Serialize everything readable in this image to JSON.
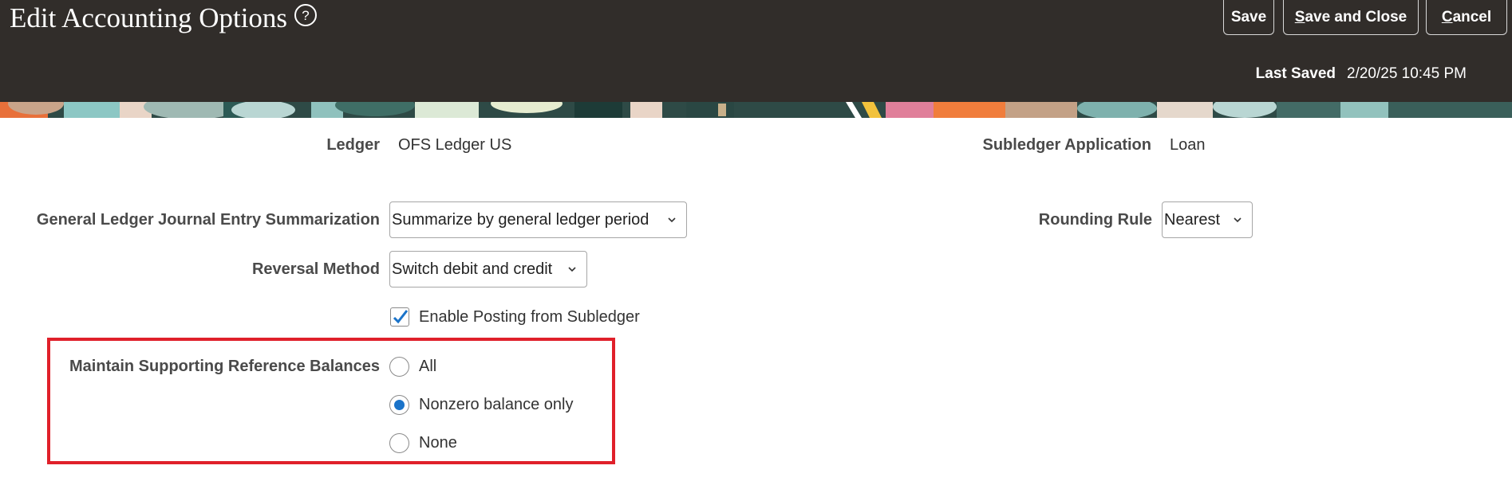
{
  "header": {
    "title": "Edit Accounting Options",
    "buttons": {
      "save": "Save",
      "save_and_close_key": "S",
      "save_and_close_rest": "ave and Close",
      "cancel_key": "C",
      "cancel_rest": "ancel"
    },
    "last_saved_label": "Last Saved",
    "last_saved_value": "2/20/25 10:45 PM"
  },
  "form": {
    "ledger_label": "Ledger",
    "ledger_value": "OFS Ledger US",
    "subledger_label": "Subledger Application",
    "subledger_value": "Loan",
    "summarization_label": "General Ledger Journal Entry Summarization",
    "summarization_value": "Summarize by general ledger period",
    "rounding_label": "Rounding Rule",
    "rounding_value": "Nearest",
    "reversal_label": "Reversal Method",
    "reversal_value": "Switch debit and credit",
    "posting_label": "Enable Posting from Subledger",
    "posting_checked": true,
    "balances_label": "Maintain Supporting Reference Balances",
    "balances_options": [
      "All",
      "Nonzero balance only",
      "None"
    ],
    "balances_selected": "Nonzero balance only"
  },
  "colors": {
    "header_bg": "#312d2a",
    "highlight_border": "#e0202a",
    "accent": "#1a73c9"
  }
}
